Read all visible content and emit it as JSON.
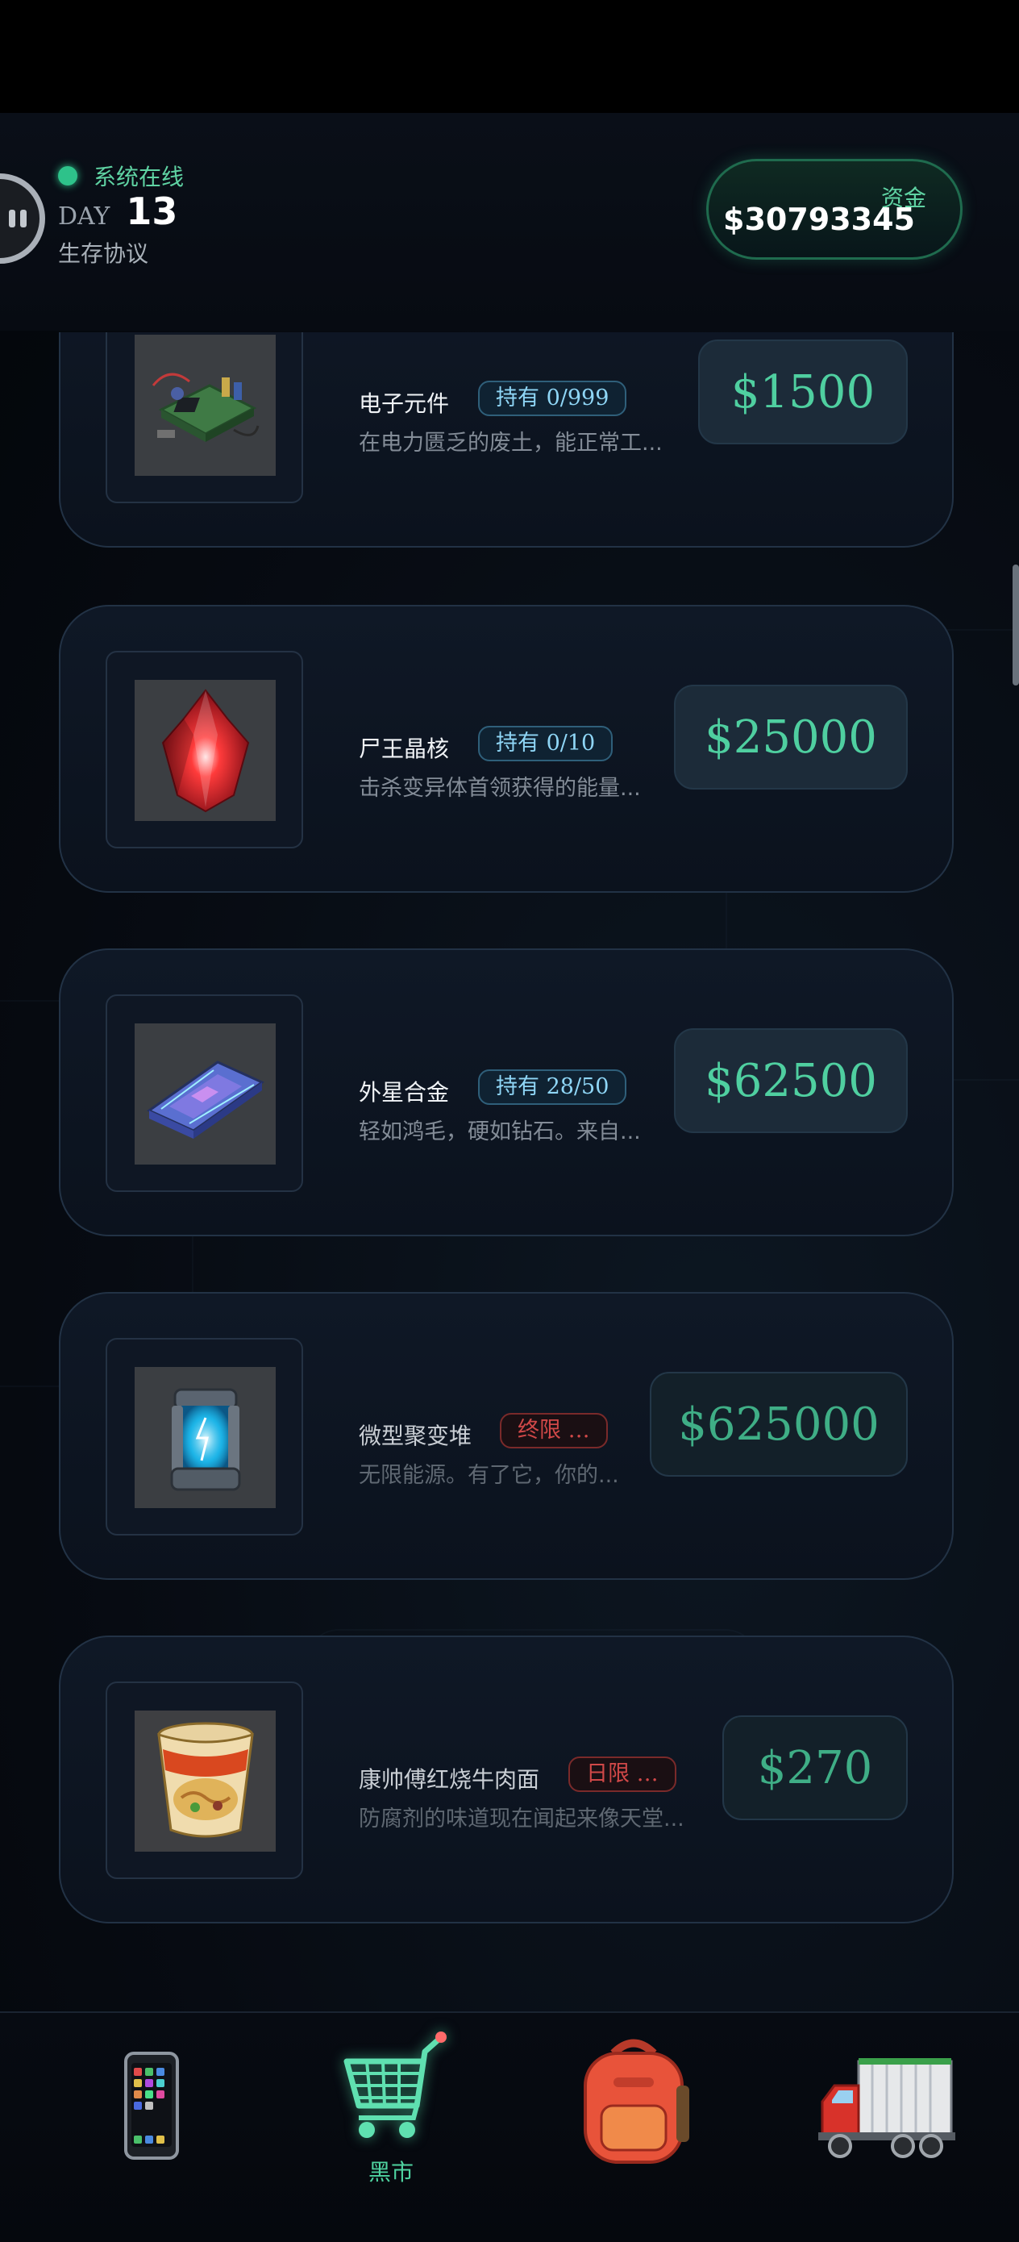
{
  "header": {
    "status_text": "系统在线",
    "day_label": "DAY",
    "day_value": "13",
    "protocol_label": "生存协议",
    "funds_label": "资金",
    "funds_value": "$30793345"
  },
  "items": [
    {
      "name": "电子元件",
      "badge": "持有 0/999",
      "badge_type": "hold",
      "desc": "在电力匮乏的废土，能正常工...",
      "price": "$1500",
      "icon": "circuit-board-icon"
    },
    {
      "name": "尸王晶核",
      "badge": "持有 0/10",
      "badge_type": "hold",
      "desc": "击杀变异体首领获得的能量...",
      "price": "$25000",
      "icon": "red-crystal-icon"
    },
    {
      "name": "外星合金",
      "badge": "持有 28/50",
      "badge_type": "hold",
      "desc": "轻如鸿毛，硬如钻石。来自...",
      "price": "$62500",
      "icon": "alien-alloy-ingot-icon"
    },
    {
      "name": "微型聚变堆",
      "badge": "终限 …",
      "badge_type": "limit",
      "desc": "无限能源。有了它，你的...",
      "price": "$625000",
      "icon": "fusion-reactor-icon"
    },
    {
      "name": "康帅傅红烧牛肉面",
      "badge": "日限 …",
      "badge_type": "limit",
      "desc": "防腐剂的味道现在闻起来像天堂...",
      "price": "$270",
      "icon": "instant-noodle-cup-icon"
    }
  ],
  "nav": {
    "phone_icon": "phone-icon",
    "market_icon": "shopping-cart-icon",
    "market_label": "黑市",
    "backpack_icon": "backpack-icon",
    "truck_icon": "truck-icon"
  },
  "colors": {
    "accent_green": "#4fcfa0",
    "status_green": "#2ec28a",
    "hold_badge": "#8fd6f6",
    "limit_badge": "#d04848"
  }
}
